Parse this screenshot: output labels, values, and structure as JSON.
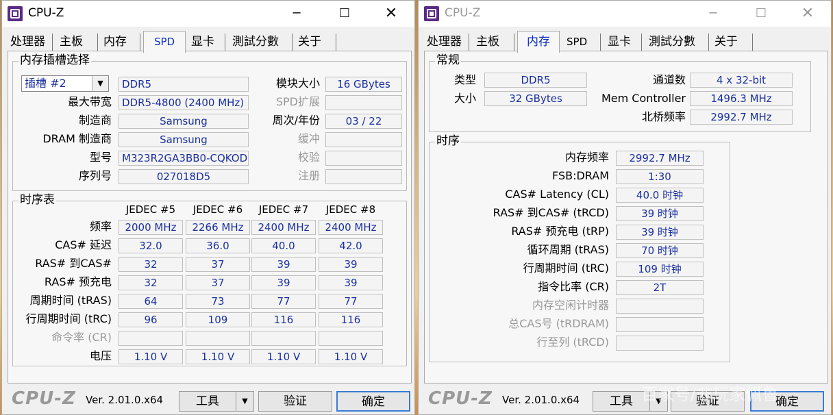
{
  "win1": {
    "title": "CPU-Z",
    "tabs": [
      "处理器",
      "主板",
      "内存",
      "SPD",
      "显卡",
      "測試分數",
      "关于"
    ],
    "slot_group_title": "内存插槽选择",
    "slot_select": "插槽 #2",
    "mem_type": "DDR5",
    "labels": {
      "max_bw": "最大带宽",
      "manufacturer": "制造商",
      "dram_mfr": "DRAM 制造商",
      "part": "型号",
      "serial": "序列号",
      "module_size": "模块大小",
      "spd_ext": "SPD扩展",
      "week_year": "周次/年份",
      "buffered": "缓冲",
      "registered": "校验",
      "correction": "注册"
    },
    "values": {
      "max_bw": "DDR5-4800 (2400 MHz)",
      "manufacturer": "Samsung",
      "dram_mfr": "Samsung",
      "part": "M323R2GA3BB0-CQKOD",
      "serial": "027018D5",
      "module_size": "16 GBytes",
      "week_year": "03 / 22"
    },
    "timing_group_title": "时序表",
    "timing_cols": [
      "JEDEC #5",
      "JEDEC #6",
      "JEDEC #7",
      "JEDEC #8"
    ],
    "timing_rows": [
      {
        "label": "频率",
        "vals": [
          "2000 MHz",
          "2266 MHz",
          "2400 MHz",
          "2400 MHz"
        ],
        "gray": false
      },
      {
        "label": "CAS# 延迟",
        "vals": [
          "32.0",
          "36.0",
          "40.0",
          "42.0"
        ],
        "gray": false
      },
      {
        "label": "RAS# 到CAS#",
        "vals": [
          "32",
          "37",
          "39",
          "39"
        ],
        "gray": false
      },
      {
        "label": "RAS# 预充电",
        "vals": [
          "32",
          "37",
          "39",
          "39"
        ],
        "gray": false
      },
      {
        "label": "周期时间 (tRAS)",
        "vals": [
          "64",
          "73",
          "77",
          "77"
        ],
        "gray": false
      },
      {
        "label": "行周期时间 (tRC)",
        "vals": [
          "96",
          "109",
          "116",
          "116"
        ],
        "gray": false
      },
      {
        "label": "命令率 (CR)",
        "vals": [
          "",
          "",
          "",
          ""
        ],
        "gray": true
      },
      {
        "label": "电压",
        "vals": [
          "1.10 V",
          "1.10 V",
          "1.10 V",
          "1.10 V"
        ],
        "gray": false
      }
    ]
  },
  "win2": {
    "title": "CPU-Z",
    "tabs": [
      "处理器",
      "主板",
      "内存",
      "SPD",
      "显卡",
      "測試分數",
      "关于"
    ],
    "general_title": "常规",
    "labels": {
      "type": "类型",
      "size": "大小",
      "channels": "通道数",
      "mem_ctrl": "Mem Controller",
      "nb_freq": "北桥频率"
    },
    "values": {
      "type": "DDR5",
      "size": "32 GBytes",
      "channels": "4 x 32-bit",
      "mem_ctrl": "1496.3 MHz",
      "nb_freq": "2992.7 MHz"
    },
    "timing_title": "时序",
    "timing_rows": [
      {
        "label": "内存频率",
        "val": "2992.7 MHz",
        "gray": false
      },
      {
        "label": "FSB:DRAM",
        "val": "1:30",
        "gray": false
      },
      {
        "label": "CAS# Latency (CL)",
        "val": "40.0 时钟",
        "gray": false
      },
      {
        "label": "RAS# 到CAS# (tRCD)",
        "val": "39 时钟",
        "gray": false
      },
      {
        "label": "RAS# 预充电 (tRP)",
        "val": "39 时钟",
        "gray": false
      },
      {
        "label": "循环周期 (tRAS)",
        "val": "70 时钟",
        "gray": false
      },
      {
        "label": "行周期时间 (tRC)",
        "val": "109 时钟",
        "gray": false
      },
      {
        "label": "指令比率 (CR)",
        "val": "2T",
        "gray": false
      },
      {
        "label": "内存空闲计时器",
        "val": "",
        "gray": true
      },
      {
        "label": "总CAS号 (tRDRAM)",
        "val": "",
        "gray": true
      },
      {
        "label": "行至列 (tRCD)",
        "val": "",
        "gray": true
      }
    ]
  },
  "footer": {
    "logo": "CPU-Z",
    "version": "Ver. 2.01.0.x64",
    "tools": "工具",
    "validate": "验证",
    "ok": "确定"
  },
  "watermark": "百家号/非玩家佩鲁"
}
